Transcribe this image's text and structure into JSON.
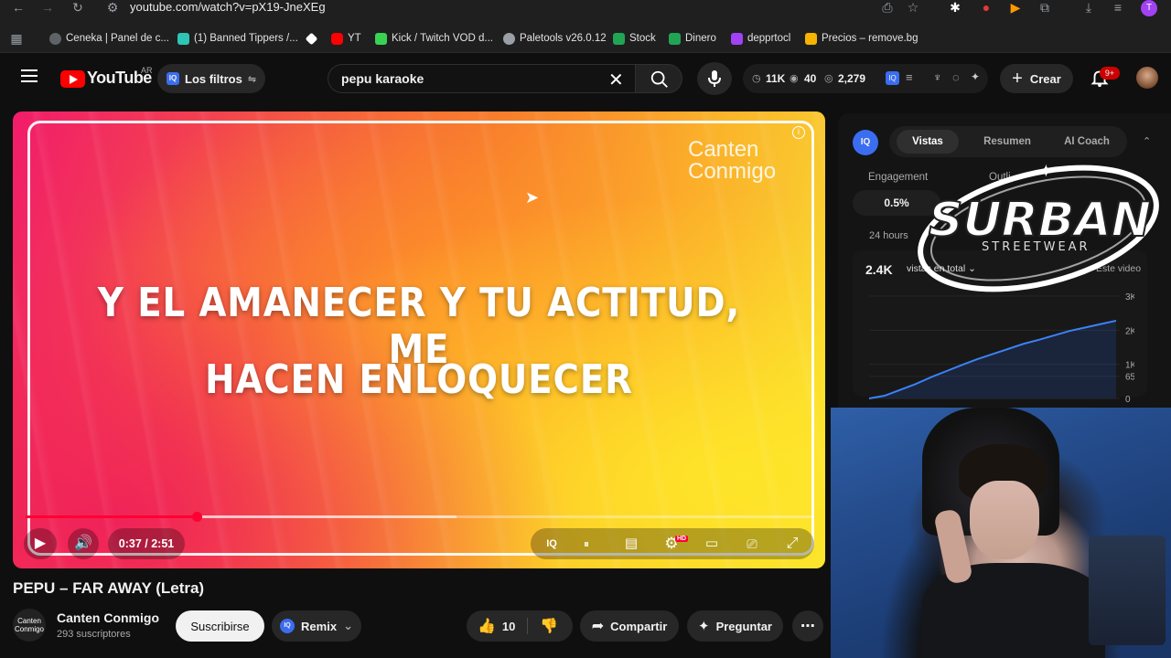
{
  "browser": {
    "url": "youtube.com/watch?v=pX19-JneXEg",
    "bookmarks": [
      {
        "label": "Ceneka | Panel de c...",
        "color": "#5f6368"
      },
      {
        "label": "(1) Banned Tippers /...",
        "color": "#2ec4b6"
      },
      {
        "label": "",
        "color": "#ffffff"
      },
      {
        "label": "YT",
        "color": "#ff0000"
      },
      {
        "label": "Kick / Twitch VOD d...",
        "color": "#39d353"
      },
      {
        "label": "Paletools v26.0.12",
        "color": "#9aa0a6"
      },
      {
        "label": "Stock",
        "color": "#22a455"
      },
      {
        "label": "Dinero",
        "color": "#22a455"
      },
      {
        "label": "depprtocl",
        "color": "#a142f4"
      },
      {
        "label": "Precios – remove.bg",
        "color": "#f4b400"
      }
    ]
  },
  "header": {
    "logo": "YouTube",
    "region": "AR",
    "filters_label": "Los filtros",
    "search_value": "pepu karaoke",
    "stats": {
      "subs": "11K",
      "viewers": "40",
      "views": "2,279"
    },
    "create_label": "Crear",
    "notif_badge": "9+"
  },
  "player": {
    "lyrics_line1": "Y EL AMANECER Y TU ACTITUD, ME",
    "lyrics_line2": "HACEN ENLOQUECER",
    "watermark_line1": "Canten",
    "watermark_line2": "Conmigo",
    "time": "0:37 / 2:51",
    "progress_fraction": 0.217,
    "buffer_fraction": 0.546,
    "hd_badge": "HD"
  },
  "video": {
    "title": "PEPU – FAR AWAY (Letra)",
    "channel": "Canten Conmigo",
    "subscribers": "293 suscriptores",
    "subscribe_label": "Suscribirse",
    "remix_label": "Remix",
    "likes": "10",
    "share_label": "Compartir",
    "ask_label": "Preguntar"
  },
  "sidepanel": {
    "tabs": [
      "Vistas",
      "Resumen",
      "AI Coach"
    ],
    "engagement_label": "Engagement",
    "outlier_label": "Outli",
    "engagement_value": "0.5%",
    "range_label": "24 hours",
    "views_value": "2.4K",
    "views_dropdown": "vistas en total",
    "este_video": "Este video",
    "yticks": [
      "3K",
      "2K",
      "1K",
      "650",
      "0"
    ],
    "chart_series": [
      0,
      80,
      250,
      420,
      620,
      800,
      980,
      1150,
      1300,
      1450,
      1600,
      1720,
      1850,
      1980,
      2080,
      2180,
      2279
    ]
  },
  "overlay": {
    "surban_title": "SURBAN",
    "surban_sub": "STREETWEAR"
  }
}
